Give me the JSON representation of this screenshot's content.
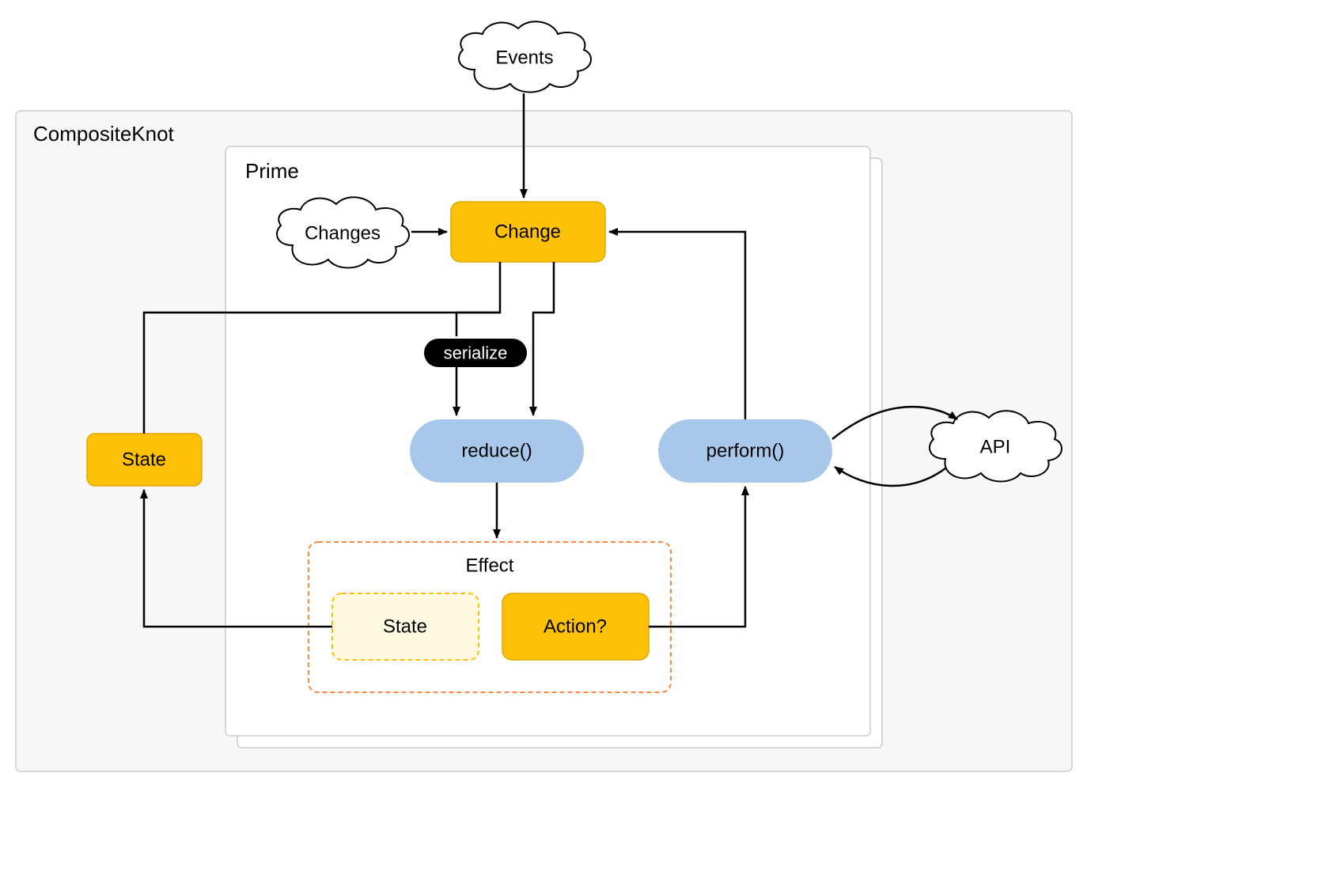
{
  "frames": {
    "outer": "CompositeKnot",
    "inner": "Prime",
    "effect": "Effect"
  },
  "clouds": {
    "events": "Events",
    "changes": "Changes",
    "api": "API"
  },
  "nodes": {
    "state_left": "State",
    "change": "Change",
    "serialize": "serialize",
    "reduce": "reduce()",
    "perform": "perform()",
    "effect_state": "State",
    "effect_action": "Action?"
  }
}
